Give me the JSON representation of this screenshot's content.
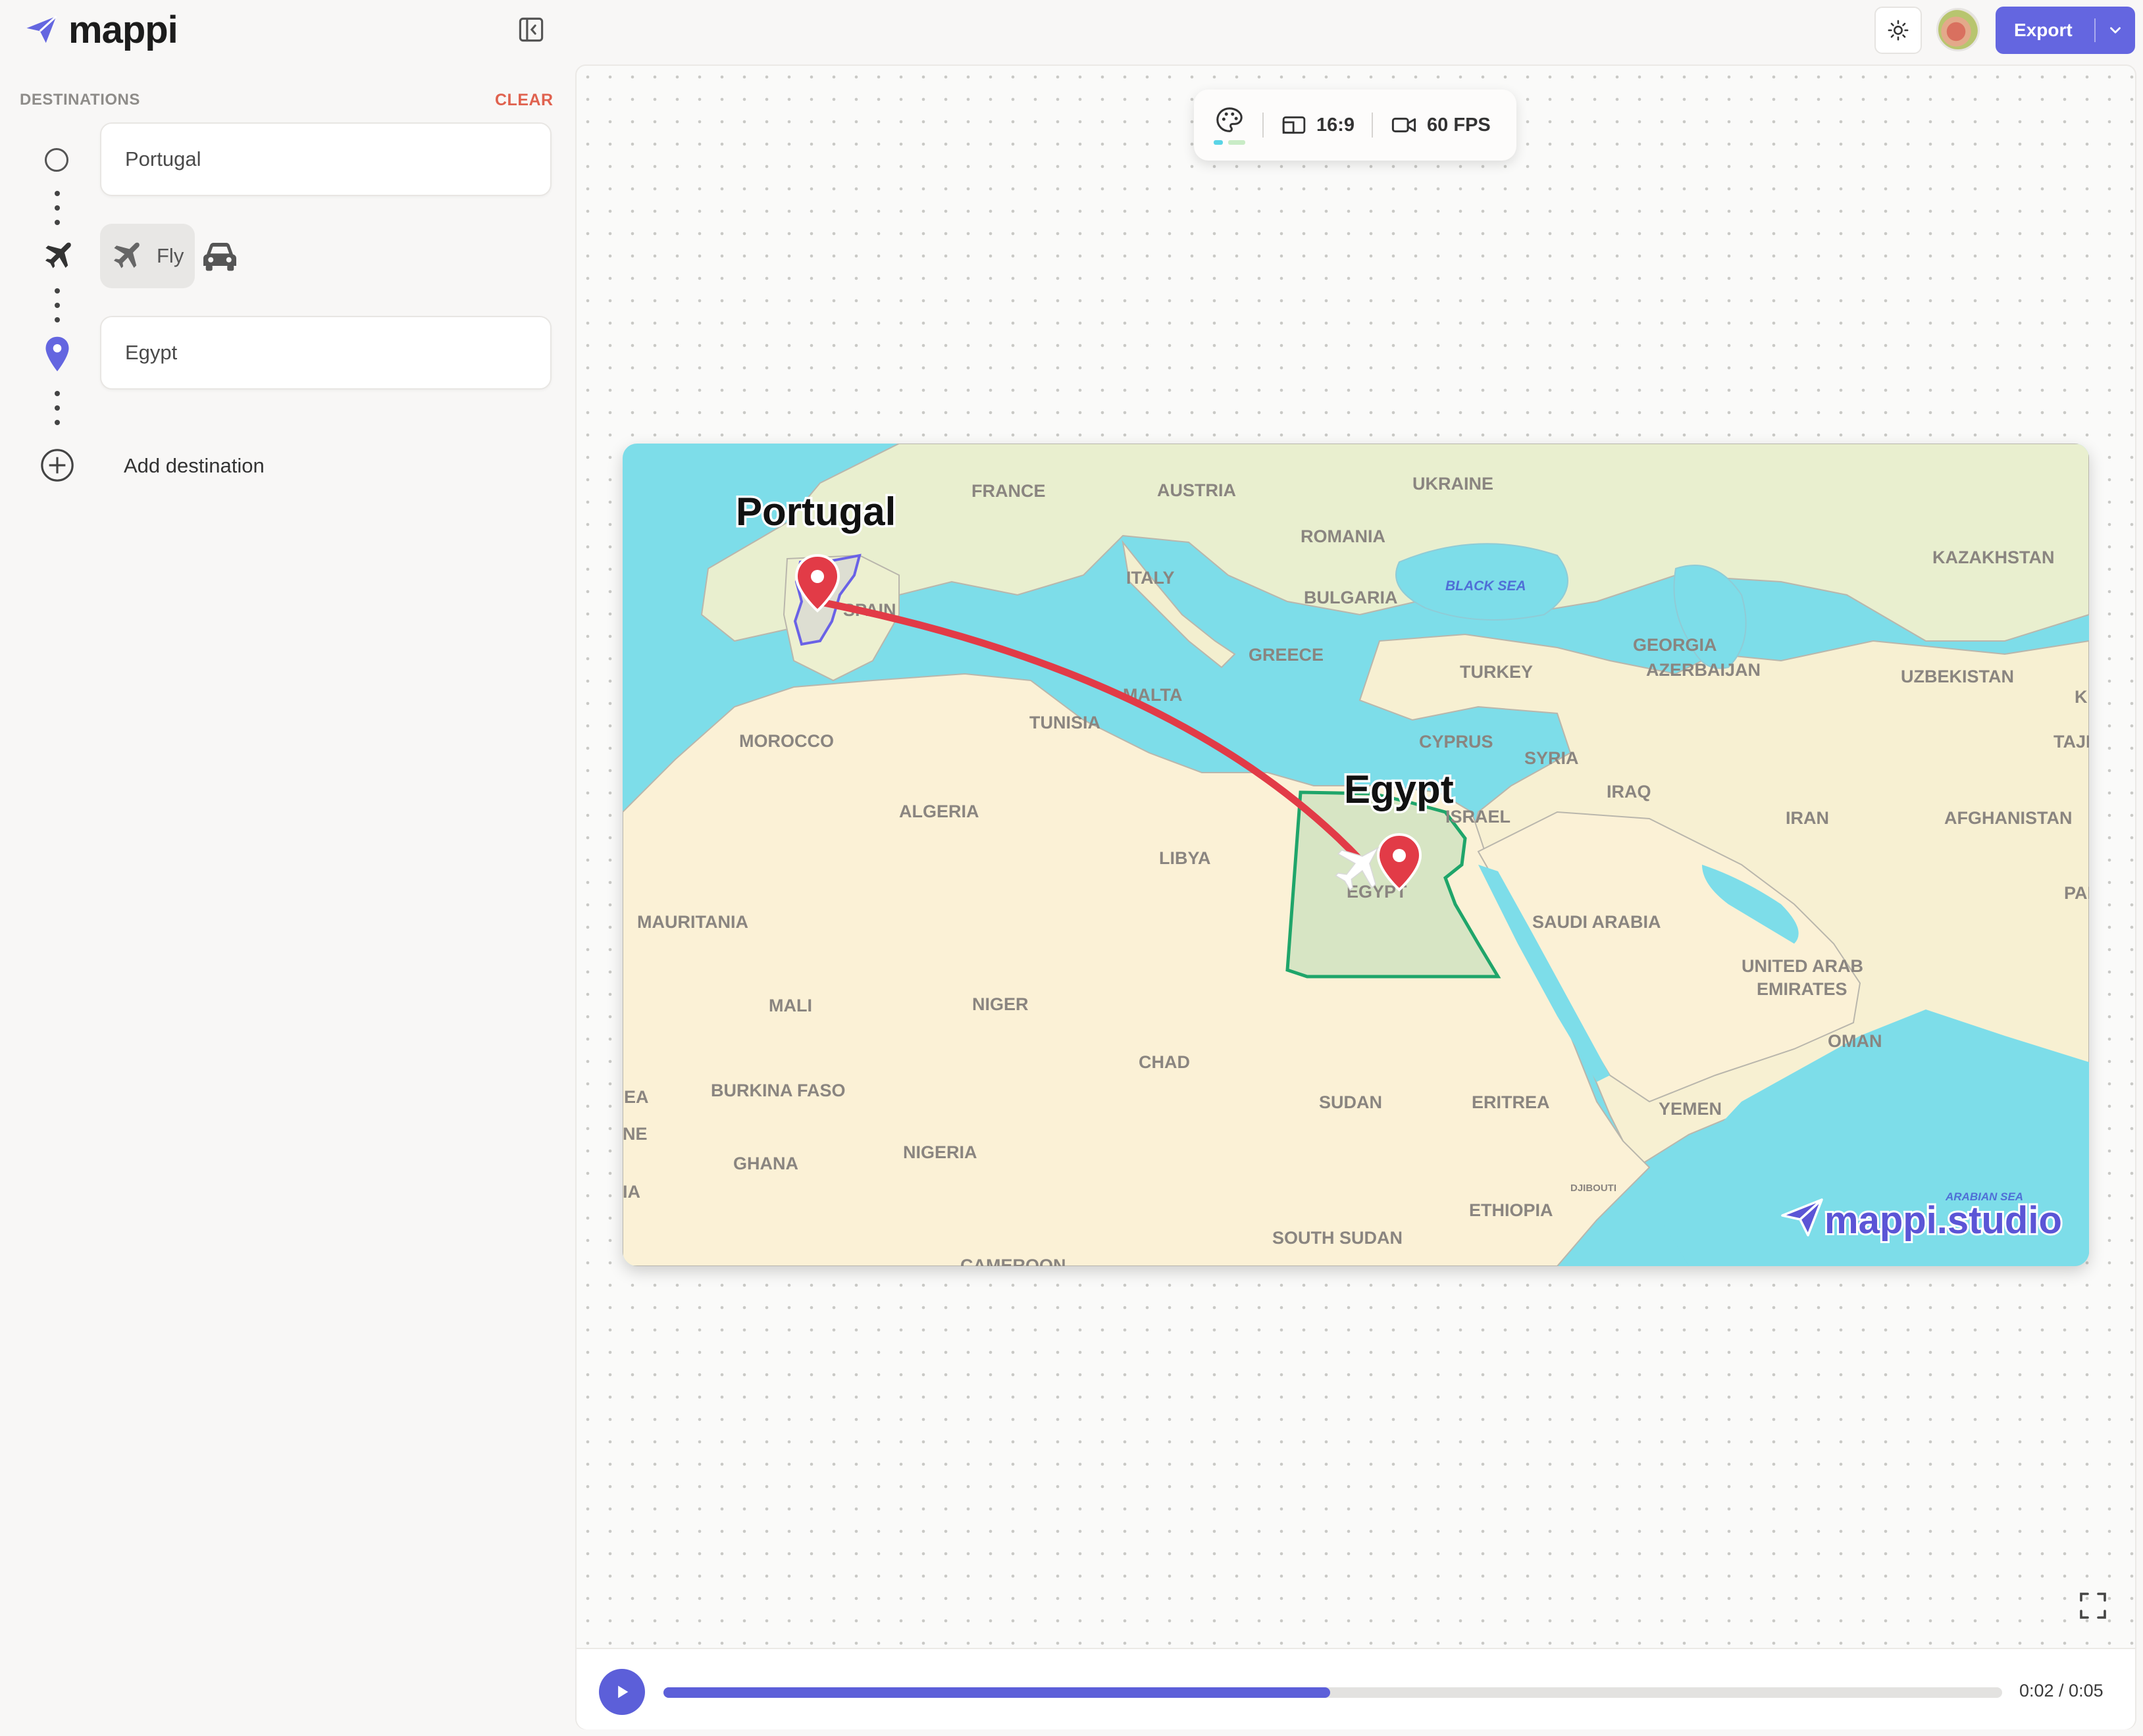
{
  "app": {
    "name": "mappi"
  },
  "header": {
    "export_label": "Export"
  },
  "sidebar": {
    "heading": "DESTINATIONS",
    "clear_label": "CLEAR",
    "destinations": [
      {
        "value": "Portugal"
      },
      {
        "value": "Egypt"
      }
    ],
    "travel_mode": {
      "selected_label": "Fly",
      "options": [
        "plane-icon",
        "car-icon"
      ]
    },
    "add_destination_label": "Add destination"
  },
  "toolbar": {
    "aspect_ratio": "16:9",
    "fps": "60 FPS"
  },
  "map": {
    "origin_label": "Portugal",
    "destination_label": "Egypt",
    "countries": [
      "FRANCE",
      "AUSTRIA",
      "UKRAINE",
      "ROMANIA",
      "KAZAKHSTAN",
      "ITALY",
      "BULGARIA",
      "SPAIN",
      "GREECE",
      "GEORGIA",
      "AZERBAIJAN",
      "TURKEY",
      "UZBEKISTAN",
      "MALTA",
      "TUNISIA",
      "MOROCCO",
      "CYPRUS",
      "SYRIA",
      "TAJIKIS",
      "ALGERIA",
      "IRAQ",
      "ISRAEL",
      "IRAN",
      "AFGHANISTAN",
      "LIBYA",
      "EGYPT",
      "PAK",
      "MAURITANIA",
      "SAUDI ARABIA",
      "UNITED ARAB",
      "EMIRATES",
      "MALI",
      "NIGER",
      "OMAN",
      "CHAD",
      "SUDAN",
      "ERITREA",
      "YEMEN",
      "BURKINA FASO",
      "GHANA",
      "NIGERIA",
      "DJIBOUTI",
      "ETHIOPIA",
      "SOUTH SUDAN",
      "CAMEROON",
      "EA",
      "NE",
      "IA",
      "K"
    ],
    "seas": [
      "BLACK SEA",
      "ARABIAN SEA"
    ],
    "watermark": "mappi.studio",
    "route_color": "#e23b47",
    "origin_outline_color": "#6a62e6",
    "destination_outline_color": "#1fa56a"
  },
  "player": {
    "progress": 0.498,
    "current_time": "0:02",
    "total_time": "0:05",
    "time_display": "0:02 / 0:05"
  },
  "colors": {
    "accent": "#5c5fd9",
    "danger": "#e0624f",
    "water": "#7ddde9",
    "land": "#fbf1d6"
  }
}
